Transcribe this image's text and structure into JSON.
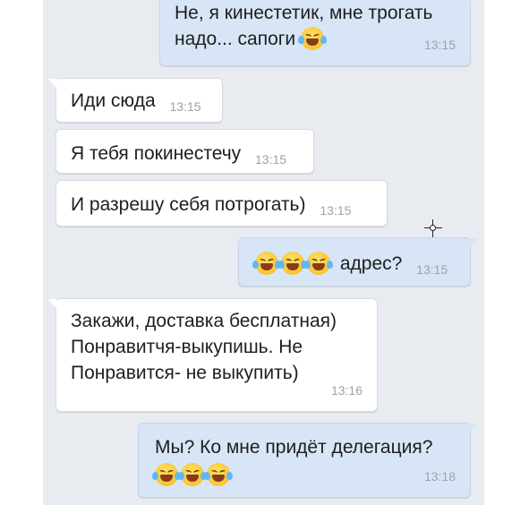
{
  "messages": [
    {
      "dir": "out",
      "lines": [
        "Не, я кинестетик, мне трогать",
        "надо... сапоги"
      ],
      "emoji_count": 1,
      "time": "13:15"
    },
    {
      "dir": "in",
      "text": "Иди сюда",
      "time": "13:15"
    },
    {
      "dir": "in",
      "text": "Я тебя покинестечу",
      "time": "13:15"
    },
    {
      "dir": "in",
      "text": "И разрешу себя потрогать)",
      "time": "13:15"
    },
    {
      "dir": "out",
      "text": "адрес?",
      "emoji_count": 3,
      "time": "13:15"
    },
    {
      "dir": "in",
      "lines": [
        "Закажи, доставка бесплатная)",
        "Понравитчя-выкупишь. Не",
        "Понравится- не выкупить)"
      ],
      "time": "13:16"
    },
    {
      "dir": "out",
      "text": "Мы? Ко мне придёт делегация?",
      "emoji_count": 3,
      "time": "13:18"
    }
  ],
  "emoji": {
    "name": "face-with-tears-of-joy-icon"
  },
  "colors": {
    "outgoing_bubble": "#d7e5f6",
    "incoming_bubble": "#ffffff",
    "background": "#e8ecf1",
    "time_text": "#9ba3ad"
  }
}
